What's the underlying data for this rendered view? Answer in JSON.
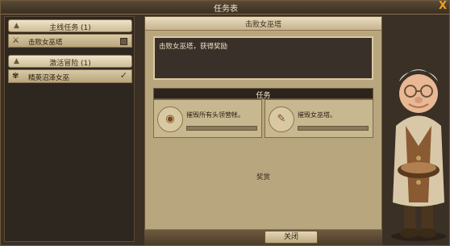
{
  "window": {
    "title": "任务表",
    "close_symbol": "X"
  },
  "sidebar": {
    "groups": [
      {
        "label": "主线任务 (1)",
        "items": [
          {
            "label": "击败女巫塔"
          }
        ]
      },
      {
        "label": "激活冒险 (1)",
        "items": [
          {
            "label": "精英沼泽女巫"
          }
        ]
      }
    ]
  },
  "quest": {
    "title": "击败女巫塔",
    "description": "击败女巫塔，获得奖励",
    "tasks_header": "任务",
    "tasks": [
      {
        "label": "摧毁所有头领营帐。",
        "icon": "camp-icon"
      },
      {
        "label": "摧毁女巫塔。",
        "icon": "scroll-icon"
      }
    ],
    "rewards_label": "奖赏"
  },
  "footer": {
    "close_label": "关闭"
  }
}
